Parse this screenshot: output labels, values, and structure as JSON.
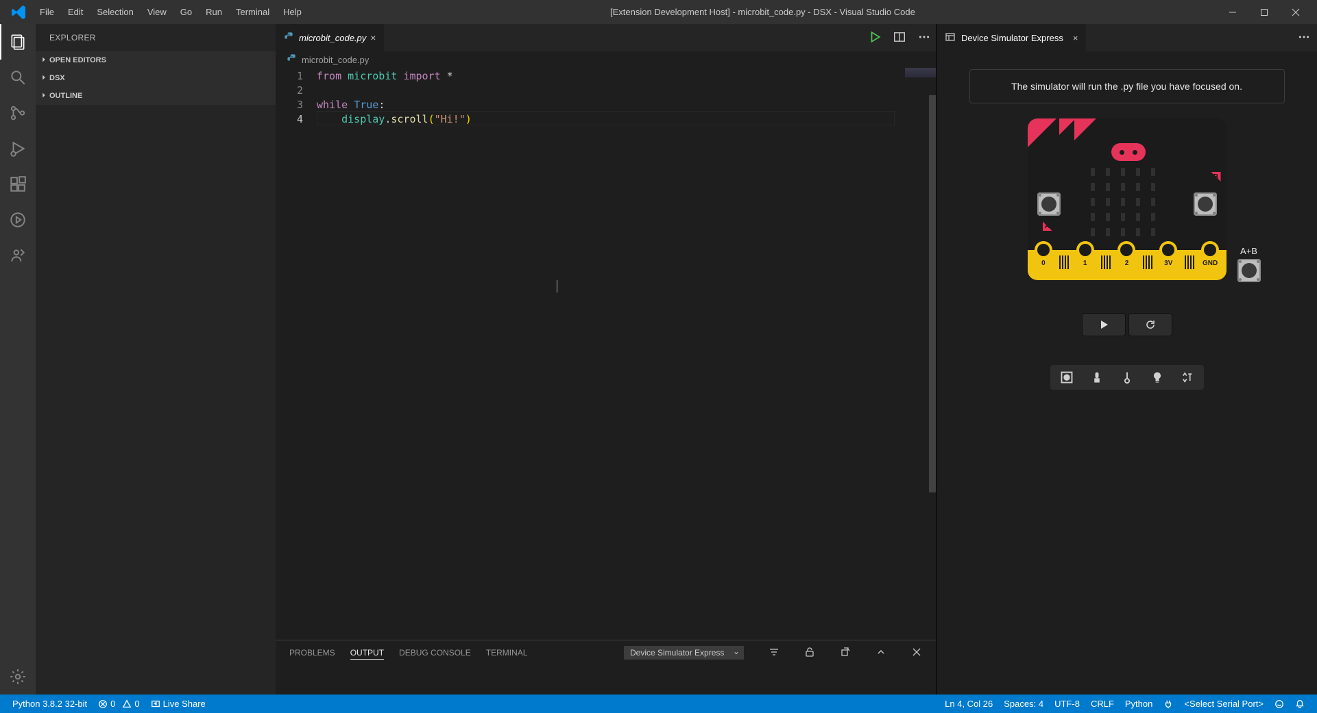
{
  "window": {
    "title": "[Extension Development Host] - microbit_code.py - DSX - Visual Studio Code"
  },
  "menu": {
    "file": "File",
    "edit": "Edit",
    "selection": "Selection",
    "view": "View",
    "go": "Go",
    "run": "Run",
    "terminal": "Terminal",
    "help": "Help"
  },
  "sidebar": {
    "header": "Explorer",
    "sections": {
      "open_editors": "OPEN EDITORS",
      "folder": "DSX",
      "outline": "OUTLINE"
    }
  },
  "editor": {
    "tab_label": "microbit_code.py",
    "breadcrumb": "microbit_code.py",
    "lines": {
      "l1": {
        "n": "1"
      },
      "l2": {
        "n": "2"
      },
      "l3": {
        "n": "3"
      },
      "l4": {
        "n": "4"
      }
    },
    "code": {
      "l1_from": "from",
      "l1_mod": "microbit",
      "l1_import": "import",
      "l1_star": "*",
      "l3_while": "while",
      "l3_true": "True",
      "l3_colon": ":",
      "l4_obj": "display",
      "l4_dot": ".",
      "l4_fn": "scroll",
      "l4_open": "(",
      "l4_str": "\"Hi!\"",
      "l4_close": ")"
    }
  },
  "simulator": {
    "tab_label": "Device Simulator Express",
    "message": "The simulator will run the .py file you have focused on.",
    "pins": {
      "p0": "0",
      "p1": "1",
      "p2": "2",
      "p3v": "3V",
      "pgnd": "GND"
    },
    "ab_label": "A+B",
    "btnA": "A",
    "btnB": "B"
  },
  "panel": {
    "tabs": {
      "problems": "PROBLEMS",
      "output": "OUTPUT",
      "debug": "DEBUG CONSOLE",
      "terminal": "TERMINAL"
    },
    "dropdown": "Device Simulator Express"
  },
  "status": {
    "python": "Python 3.8.2 32-bit",
    "errors": "0",
    "warnings": "0",
    "liveshare": "Live Share",
    "cursor": "Ln 4, Col 26",
    "spaces": "Spaces: 4",
    "encoding": "UTF-8",
    "eol": "CRLF",
    "lang": "Python",
    "serial": "<Select Serial Port>"
  }
}
